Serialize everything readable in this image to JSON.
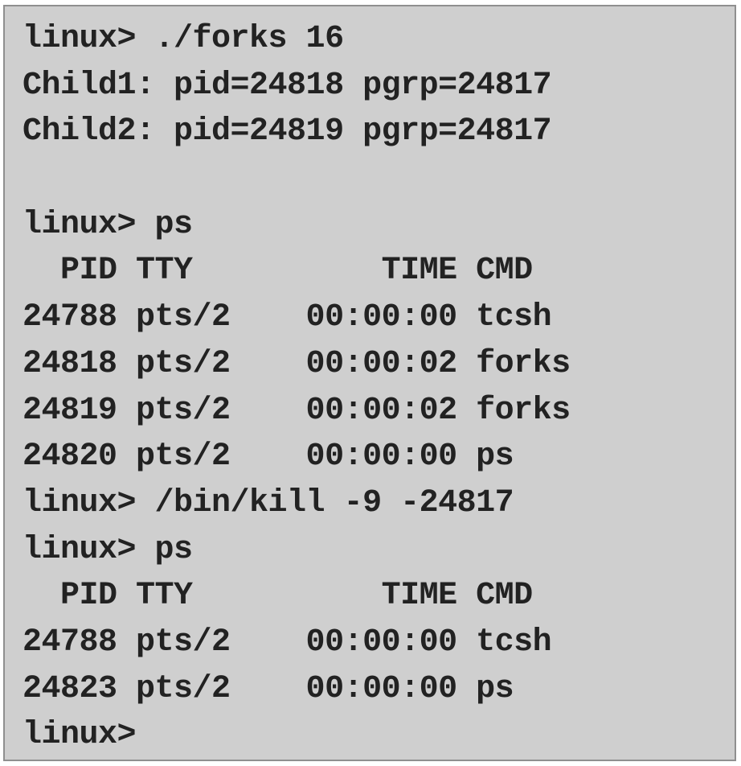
{
  "terminal": {
    "lines": [
      "linux> ./forks 16",
      "Child1: pid=24818 pgrp=24817",
      "Child2: pid=24819 pgrp=24817",
      "",
      "linux> ps",
      "  PID TTY          TIME CMD",
      "24788 pts/2    00:00:00 tcsh",
      "24818 pts/2    00:00:02 forks",
      "24819 pts/2    00:00:02 forks",
      "24820 pts/2    00:00:00 ps",
      "linux> /bin/kill -9 -24817",
      "linux> ps",
      "  PID TTY          TIME CMD",
      "24788 pts/2    00:00:00 tcsh",
      "24823 pts/2    00:00:00 ps",
      "linux>"
    ]
  }
}
